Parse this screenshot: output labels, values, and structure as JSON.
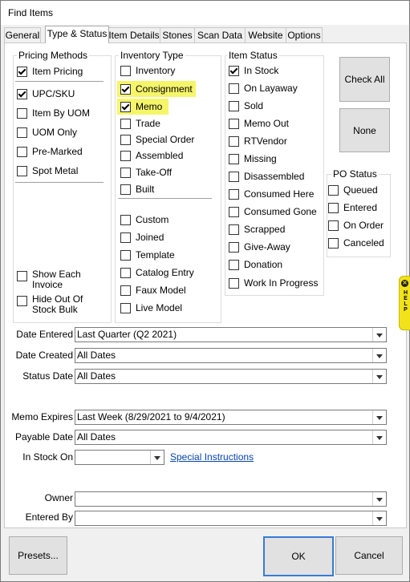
{
  "window": {
    "title": "Find Items"
  },
  "tabs": [
    "General",
    "Type & Status",
    "Item Details",
    "Stones",
    "Scan Data",
    "Website",
    "Options"
  ],
  "pricing_methods": {
    "title": "Pricing Methods",
    "items": [
      {
        "label": "Item Pricing",
        "checked": true
      },
      {
        "label": "UPC/SKU",
        "checked": true
      },
      {
        "label": "Item By UOM",
        "checked": false
      },
      {
        "label": "UOM Only",
        "checked": false
      },
      {
        "label": "Pre-Marked",
        "checked": false
      },
      {
        "label": "Spot Metal",
        "checked": false
      }
    ],
    "show_each_invoice": {
      "line1": "Show Each",
      "line2": "Invoice",
      "checked": false
    },
    "hide_out_of_stock": {
      "line1": "Hide Out Of",
      "line2": "Stock Bulk",
      "checked": false
    }
  },
  "inventory_type": {
    "title": "Inventory Type",
    "items": [
      {
        "label": "Inventory",
        "checked": false,
        "highlight": false
      },
      {
        "label": "Consignment",
        "checked": true,
        "highlight": true
      },
      {
        "label": "Memo",
        "checked": true,
        "highlight": true
      },
      {
        "label": "Trade",
        "checked": false,
        "highlight": false
      },
      {
        "label": "Special Order",
        "checked": false,
        "highlight": false
      },
      {
        "label": "Assembled",
        "checked": false,
        "highlight": false
      },
      {
        "label": "Take-Off",
        "checked": false,
        "highlight": false
      },
      {
        "label": "Built",
        "checked": false,
        "highlight": false
      },
      {
        "label": "Custom",
        "checked": false,
        "highlight": false
      },
      {
        "label": "Joined",
        "checked": false,
        "highlight": false
      },
      {
        "label": "Template",
        "checked": false,
        "highlight": false
      },
      {
        "label": "Catalog Entry",
        "checked": false,
        "highlight": false
      },
      {
        "label": "Faux Model",
        "checked": false,
        "highlight": false
      },
      {
        "label": "Live Model",
        "checked": false,
        "highlight": false
      }
    ],
    "highlight_color": "#f5f56a"
  },
  "item_status": {
    "title": "Item Status",
    "items": [
      {
        "label": "In Stock",
        "checked": true
      },
      {
        "label": "On Layaway",
        "checked": false
      },
      {
        "label": "Sold",
        "checked": false
      },
      {
        "label": "Memo Out",
        "checked": false
      },
      {
        "label": "RTVendor",
        "checked": false
      },
      {
        "label": "Missing",
        "checked": false
      },
      {
        "label": "Disassembled",
        "checked": false
      },
      {
        "label": "Consumed Here",
        "checked": false
      },
      {
        "label": "Consumed Gone",
        "checked": false
      },
      {
        "label": "Scrapped",
        "checked": false
      },
      {
        "label": "Give-Away",
        "checked": false
      },
      {
        "label": "Donation",
        "checked": false
      },
      {
        "label": "Work In Progress",
        "checked": false
      }
    ]
  },
  "po_status": {
    "title": "PO Status",
    "items": [
      {
        "label": "Queued",
        "checked": false
      },
      {
        "label": "Entered",
        "checked": false
      },
      {
        "label": "On Order",
        "checked": false
      },
      {
        "label": "Canceled",
        "checked": false
      }
    ]
  },
  "buttons": {
    "check_all": "Check All",
    "none": "None",
    "presets": "Presets...",
    "ok": "OK",
    "cancel": "Cancel"
  },
  "help_tab": {
    "icon": "help-x-icon",
    "text": "HELP"
  },
  "fields": {
    "date_entered": {
      "label": "Date Entered",
      "value": "Last Quarter (Q2 2021)"
    },
    "date_created": {
      "label": "Date Created",
      "value": "All Dates"
    },
    "status_date": {
      "label": "Status Date",
      "value": "All Dates"
    },
    "memo_expires": {
      "label": "Memo Expires",
      "value": "Last Week (8/29/2021 to 9/4/2021)"
    },
    "payable_date": {
      "label": "Payable Date",
      "value": "All Dates"
    },
    "in_stock_on": {
      "label": "In Stock On",
      "value": ""
    },
    "special_instructions": "Special Instructions",
    "owner": {
      "label": "Owner",
      "value": ""
    },
    "entered_by": {
      "label": "Entered By",
      "value": ""
    }
  }
}
